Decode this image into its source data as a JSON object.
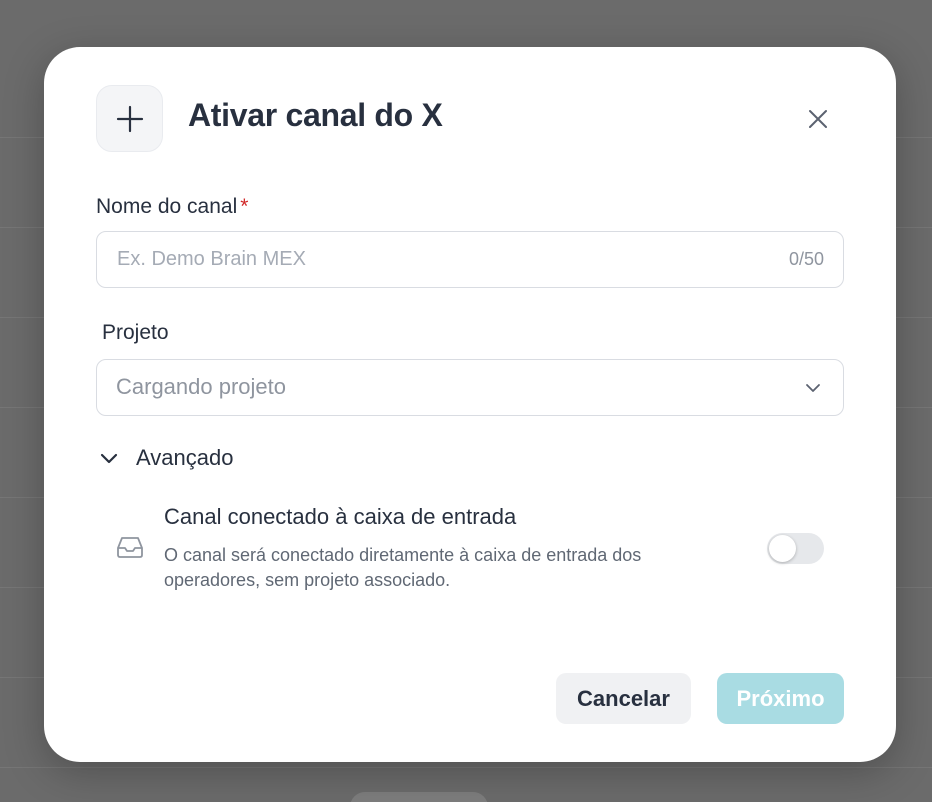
{
  "dialog": {
    "title": "Ativar canal do X",
    "name_field": {
      "label": "Nome do canal",
      "required_mark": "*",
      "placeholder": "Ex. Demo Brain MEX",
      "value": "",
      "counter": "0/50"
    },
    "project_field": {
      "label": "Projeto",
      "value": "Cargando projeto"
    },
    "advanced": {
      "label": "Avançado",
      "option_title": "Canal conectado à caixa de entrada",
      "option_description": "O canal será conectado diretamente à caixa de entrada dos operadores, sem projeto associado.",
      "toggle_on": false
    },
    "buttons": {
      "cancel": "Cancelar",
      "next": "Próximo"
    }
  },
  "icons": {
    "header": "plus-icon",
    "close": "close-icon",
    "select": "chevron-down-icon",
    "advanced": "chevron-down-icon",
    "option": "inbox-icon"
  },
  "colors": {
    "overlay": "#6b6b6b",
    "primary_disabled": "#a9dce3",
    "required": "#d12a2a",
    "text": "#28303f"
  }
}
